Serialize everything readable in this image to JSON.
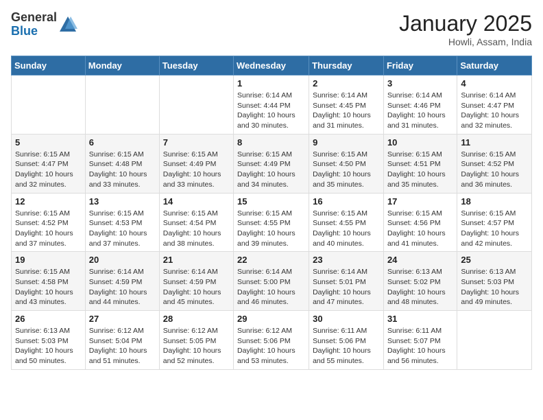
{
  "logo": {
    "general": "General",
    "blue": "Blue"
  },
  "title": "January 2025",
  "location": "Howli, Assam, India",
  "days_of_week": [
    "Sunday",
    "Monday",
    "Tuesday",
    "Wednesday",
    "Thursday",
    "Friday",
    "Saturday"
  ],
  "weeks": [
    [
      {
        "day": "",
        "sunrise": "",
        "sunset": "",
        "daylight": ""
      },
      {
        "day": "",
        "sunrise": "",
        "sunset": "",
        "daylight": ""
      },
      {
        "day": "",
        "sunrise": "",
        "sunset": "",
        "daylight": ""
      },
      {
        "day": "1",
        "sunrise": "Sunrise: 6:14 AM",
        "sunset": "Sunset: 4:44 PM",
        "daylight": "Daylight: 10 hours and 30 minutes."
      },
      {
        "day": "2",
        "sunrise": "Sunrise: 6:14 AM",
        "sunset": "Sunset: 4:45 PM",
        "daylight": "Daylight: 10 hours and 31 minutes."
      },
      {
        "day": "3",
        "sunrise": "Sunrise: 6:14 AM",
        "sunset": "Sunset: 4:46 PM",
        "daylight": "Daylight: 10 hours and 31 minutes."
      },
      {
        "day": "4",
        "sunrise": "Sunrise: 6:14 AM",
        "sunset": "Sunset: 4:47 PM",
        "daylight": "Daylight: 10 hours and 32 minutes."
      }
    ],
    [
      {
        "day": "5",
        "sunrise": "Sunrise: 6:15 AM",
        "sunset": "Sunset: 4:47 PM",
        "daylight": "Daylight: 10 hours and 32 minutes."
      },
      {
        "day": "6",
        "sunrise": "Sunrise: 6:15 AM",
        "sunset": "Sunset: 4:48 PM",
        "daylight": "Daylight: 10 hours and 33 minutes."
      },
      {
        "day": "7",
        "sunrise": "Sunrise: 6:15 AM",
        "sunset": "Sunset: 4:49 PM",
        "daylight": "Daylight: 10 hours and 33 minutes."
      },
      {
        "day": "8",
        "sunrise": "Sunrise: 6:15 AM",
        "sunset": "Sunset: 4:49 PM",
        "daylight": "Daylight: 10 hours and 34 minutes."
      },
      {
        "day": "9",
        "sunrise": "Sunrise: 6:15 AM",
        "sunset": "Sunset: 4:50 PM",
        "daylight": "Daylight: 10 hours and 35 minutes."
      },
      {
        "day": "10",
        "sunrise": "Sunrise: 6:15 AM",
        "sunset": "Sunset: 4:51 PM",
        "daylight": "Daylight: 10 hours and 35 minutes."
      },
      {
        "day": "11",
        "sunrise": "Sunrise: 6:15 AM",
        "sunset": "Sunset: 4:52 PM",
        "daylight": "Daylight: 10 hours and 36 minutes."
      }
    ],
    [
      {
        "day": "12",
        "sunrise": "Sunrise: 6:15 AM",
        "sunset": "Sunset: 4:52 PM",
        "daylight": "Daylight: 10 hours and 37 minutes."
      },
      {
        "day": "13",
        "sunrise": "Sunrise: 6:15 AM",
        "sunset": "Sunset: 4:53 PM",
        "daylight": "Daylight: 10 hours and 37 minutes."
      },
      {
        "day": "14",
        "sunrise": "Sunrise: 6:15 AM",
        "sunset": "Sunset: 4:54 PM",
        "daylight": "Daylight: 10 hours and 38 minutes."
      },
      {
        "day": "15",
        "sunrise": "Sunrise: 6:15 AM",
        "sunset": "Sunset: 4:55 PM",
        "daylight": "Daylight: 10 hours and 39 minutes."
      },
      {
        "day": "16",
        "sunrise": "Sunrise: 6:15 AM",
        "sunset": "Sunset: 4:55 PM",
        "daylight": "Daylight: 10 hours and 40 minutes."
      },
      {
        "day": "17",
        "sunrise": "Sunrise: 6:15 AM",
        "sunset": "Sunset: 4:56 PM",
        "daylight": "Daylight: 10 hours and 41 minutes."
      },
      {
        "day": "18",
        "sunrise": "Sunrise: 6:15 AM",
        "sunset": "Sunset: 4:57 PM",
        "daylight": "Daylight: 10 hours and 42 minutes."
      }
    ],
    [
      {
        "day": "19",
        "sunrise": "Sunrise: 6:15 AM",
        "sunset": "Sunset: 4:58 PM",
        "daylight": "Daylight: 10 hours and 43 minutes."
      },
      {
        "day": "20",
        "sunrise": "Sunrise: 6:14 AM",
        "sunset": "Sunset: 4:59 PM",
        "daylight": "Daylight: 10 hours and 44 minutes."
      },
      {
        "day": "21",
        "sunrise": "Sunrise: 6:14 AM",
        "sunset": "Sunset: 4:59 PM",
        "daylight": "Daylight: 10 hours and 45 minutes."
      },
      {
        "day": "22",
        "sunrise": "Sunrise: 6:14 AM",
        "sunset": "Sunset: 5:00 PM",
        "daylight": "Daylight: 10 hours and 46 minutes."
      },
      {
        "day": "23",
        "sunrise": "Sunrise: 6:14 AM",
        "sunset": "Sunset: 5:01 PM",
        "daylight": "Daylight: 10 hours and 47 minutes."
      },
      {
        "day": "24",
        "sunrise": "Sunrise: 6:13 AM",
        "sunset": "Sunset: 5:02 PM",
        "daylight": "Daylight: 10 hours and 48 minutes."
      },
      {
        "day": "25",
        "sunrise": "Sunrise: 6:13 AM",
        "sunset": "Sunset: 5:03 PM",
        "daylight": "Daylight: 10 hours and 49 minutes."
      }
    ],
    [
      {
        "day": "26",
        "sunrise": "Sunrise: 6:13 AM",
        "sunset": "Sunset: 5:03 PM",
        "daylight": "Daylight: 10 hours and 50 minutes."
      },
      {
        "day": "27",
        "sunrise": "Sunrise: 6:12 AM",
        "sunset": "Sunset: 5:04 PM",
        "daylight": "Daylight: 10 hours and 51 minutes."
      },
      {
        "day": "28",
        "sunrise": "Sunrise: 6:12 AM",
        "sunset": "Sunset: 5:05 PM",
        "daylight": "Daylight: 10 hours and 52 minutes."
      },
      {
        "day": "29",
        "sunrise": "Sunrise: 6:12 AM",
        "sunset": "Sunset: 5:06 PM",
        "daylight": "Daylight: 10 hours and 53 minutes."
      },
      {
        "day": "30",
        "sunrise": "Sunrise: 6:11 AM",
        "sunset": "Sunset: 5:06 PM",
        "daylight": "Daylight: 10 hours and 55 minutes."
      },
      {
        "day": "31",
        "sunrise": "Sunrise: 6:11 AM",
        "sunset": "Sunset: 5:07 PM",
        "daylight": "Daylight: 10 hours and 56 minutes."
      },
      {
        "day": "",
        "sunrise": "",
        "sunset": "",
        "daylight": ""
      }
    ]
  ]
}
